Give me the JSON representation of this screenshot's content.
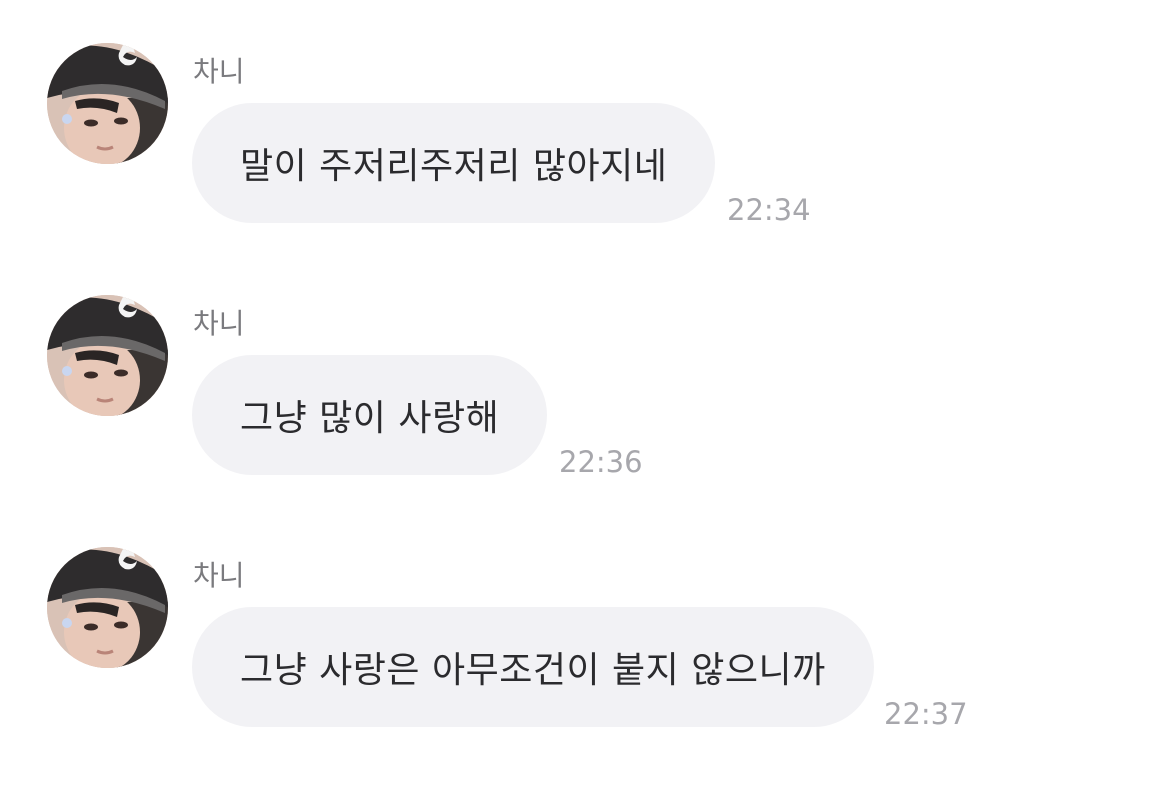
{
  "messages": [
    {
      "sender": "차니",
      "text": "말이 주저리주저리 많아지네",
      "time": "22:34"
    },
    {
      "sender": "차니",
      "text": "그냥 많이 사랑해",
      "time": "22:36"
    },
    {
      "sender": "차니",
      "text": "그냥 사랑은 아무조건이 붙지 않으니까",
      "time": "22:37"
    }
  ],
  "colors": {
    "background": "#ffffff",
    "bubble": "#f2f2f5",
    "message_text": "#2b2b2e",
    "sender_text": "#7a7a7e",
    "timestamp": "#a7a7ac"
  },
  "icons": {
    "avatar": "profile-photo"
  }
}
